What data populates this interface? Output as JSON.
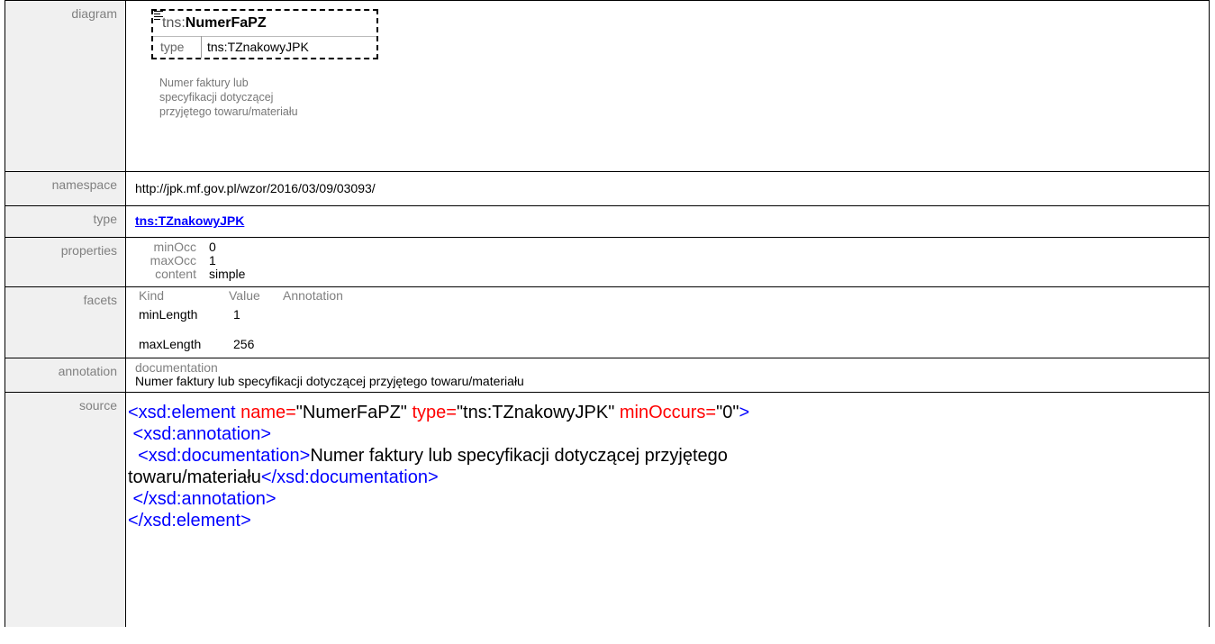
{
  "labels": {
    "diagram": "diagram",
    "namespace": "namespace",
    "type": "type",
    "properties": "properties",
    "facets": "facets",
    "annotation": "annotation",
    "source": "source"
  },
  "diagram": {
    "prefix": "tns:",
    "name": "NumerFaPZ",
    "type_key": "type",
    "type_value": "tns:TZnakowyJPK",
    "note_lines": [
      "Numer faktury lub",
      "specyfikacji dotyczącej",
      "przyjętego towaru/materiału"
    ]
  },
  "namespace": "http://jpk.mf.gov.pl/wzor/2016/03/09/03093/",
  "type_link": "tns:TZnakowyJPK",
  "properties": [
    {
      "key": "minOcc",
      "value": "0"
    },
    {
      "key": "maxOcc",
      "value": "1"
    },
    {
      "key": "content",
      "value": "simple"
    }
  ],
  "facets": {
    "headers": [
      "Kind",
      "Value",
      "Annotation"
    ],
    "rows": [
      {
        "kind": "minLength",
        "value": "1"
      },
      {
        "kind": "maxLength",
        "value": "256"
      }
    ]
  },
  "annotation": {
    "header": "documentation",
    "text": "Numer faktury lub specyfikacji dotyczącej przyjętego towaru/materiału"
  },
  "source": {
    "l1_tag_open": "<xsd:element",
    "l1_attr1": " name=",
    "l1_val1": "\"NumerFaPZ\"",
    "l1_attr2": " type=",
    "l1_val2": "\"tns:TZnakowyJPK\"",
    "l1_attr3": " minOccurs=",
    "l1_val3": "\"0\"",
    "l1_close": ">",
    "l2": " <xsd:annotation>",
    "l3_tag": "  <xsd:documentation>",
    "l3_text": "Numer faktury lub specyfikacji dotyczącej przyjętego",
    "l4_text": "towaru/materiału",
    "l4_tag": "</xsd:documentation>",
    "l5": " </xsd:annotation>",
    "l6": "</xsd:element>"
  }
}
